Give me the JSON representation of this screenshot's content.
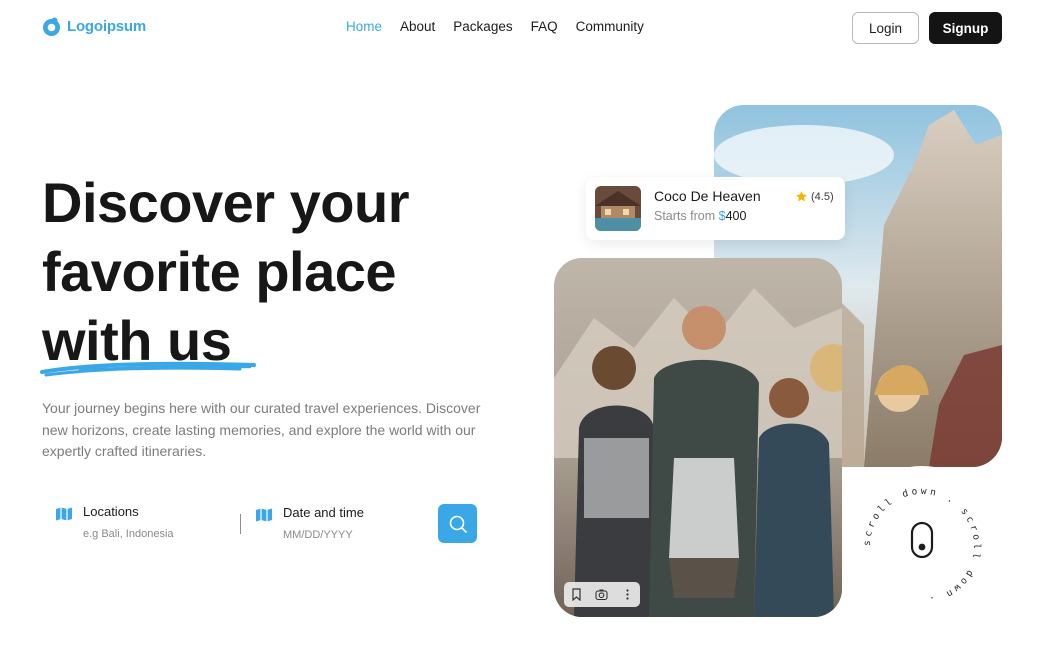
{
  "header": {
    "logo_text": "Logoipsum",
    "nav": [
      "Home",
      "About",
      "Packages",
      "FAQ",
      "Community"
    ],
    "login_label": "Login",
    "signup_label": "Signup"
  },
  "hero": {
    "title_line1": "Discover your",
    "title_line2": "favorite place",
    "title_line3": "with us",
    "description": "Your journey begins here with our curated travel experiences. Discover new horizons, create lasting memories, and explore the world with our expertly crafted itineraries."
  },
  "search": {
    "location_label": "Locations",
    "location_hint": "e.g Bali, Indonesia",
    "date_label": "Date and time",
    "date_hint": "MM/DD/YYYY"
  },
  "card": {
    "title": "Coco De Heaven",
    "starts_from": "Starts from",
    "currency": "$",
    "price": "400",
    "rating": "(4.5)"
  },
  "scroll_badge": {
    "text": "scroll down . scroll down ."
  },
  "colors": {
    "accent": "#3aa7e6",
    "dark": "#141414",
    "muted": "#7c7c7c"
  },
  "icons": [
    "logo-icon",
    "map-icon",
    "search-icon",
    "star-icon",
    "bookmark-icon",
    "lens-icon",
    "more-icon",
    "mouse-icon"
  ]
}
